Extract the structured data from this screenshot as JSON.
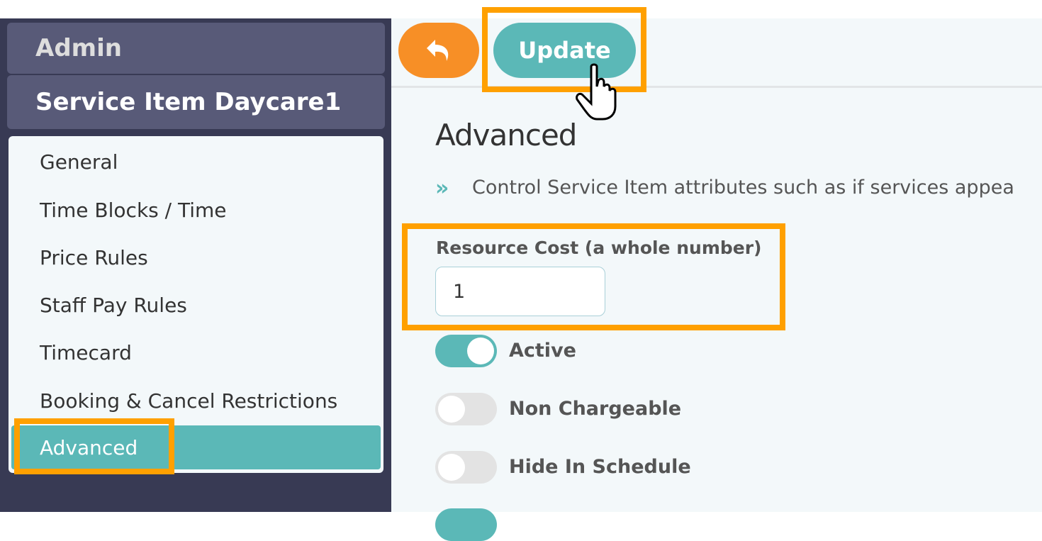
{
  "sidebar": {
    "admin": "Admin",
    "title": "Service Item Daycare1",
    "items": [
      {
        "label": "General"
      },
      {
        "label": "Time Blocks / Time"
      },
      {
        "label": "Price Rules"
      },
      {
        "label": "Staff Pay Rules"
      },
      {
        "label": "Timecard"
      },
      {
        "label": "Booking & Cancel Restrictions"
      },
      {
        "label": "Advanced",
        "active": true
      }
    ]
  },
  "toolbar": {
    "back_icon": "reply-arrow-icon",
    "update_label": "Update"
  },
  "main": {
    "heading": "Advanced",
    "description": "Control Service Item attributes such as if services appea",
    "resource_cost": {
      "label": "Resource Cost (a whole number)",
      "value": "1"
    },
    "toggles": [
      {
        "label": "Active",
        "on": true
      },
      {
        "label": "Non Chargeable",
        "on": false
      },
      {
        "label": "Hide In Schedule",
        "on": false
      }
    ]
  },
  "colors": {
    "accent": "#5bb8b7",
    "back": "#f78f26",
    "highlight": "#ffa000",
    "sidebar": "#383a54"
  }
}
